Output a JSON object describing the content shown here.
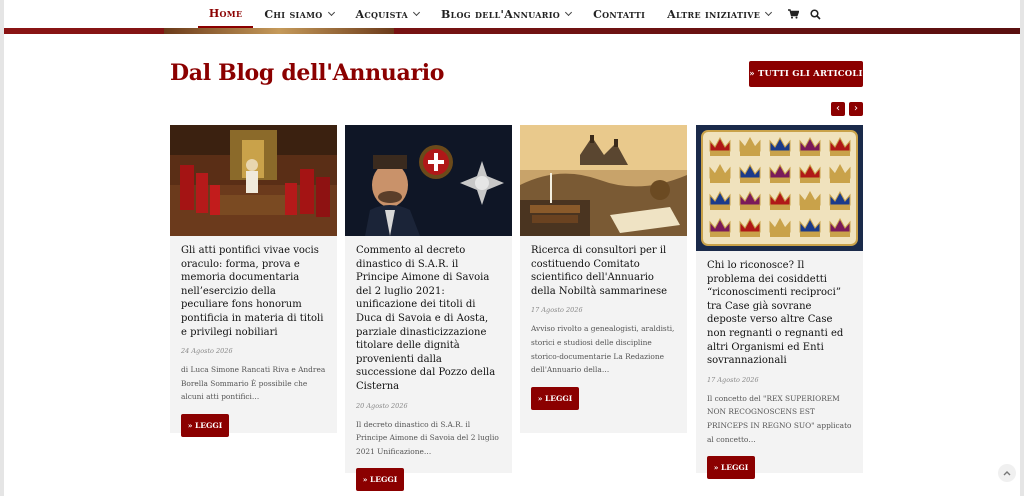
{
  "nav": {
    "items": [
      {
        "label": "Home",
        "active": true,
        "dropdown": false
      },
      {
        "label": "Chi siamo",
        "active": false,
        "dropdown": true
      },
      {
        "label": "Acquista",
        "active": false,
        "dropdown": true
      },
      {
        "label": "Blog dell'Annuario",
        "active": false,
        "dropdown": true
      },
      {
        "label": "Contatti",
        "active": false,
        "dropdown": false
      },
      {
        "label": "Altre iniziative",
        "active": false,
        "dropdown": true
      }
    ],
    "cart_icon": "cart-icon",
    "search_icon": "search-icon"
  },
  "section": {
    "title": "Dal Blog dell'Annuario",
    "all_button": "» TUTTI GLI ARTICOLI",
    "prev_icon": "chevron-left-icon",
    "next_icon": "chevron-right-icon"
  },
  "colors": {
    "accent": "#8b0000",
    "card_bg": "#f3f3f3"
  },
  "cards": [
    {
      "image": "papal-audience-painting",
      "title": "Gli atti pontifici vivae vocis oraculo: forma, prova e memoria documentaria nell’esercizio della peculiare fons honorum pontificia in materia di titoli e privilegi nobiliari",
      "date": "24 Agosto 2026",
      "excerpt": "di Luca Simone Rancati Riva e Andrea Borella Sommario È possibile che alcuni atti pontifici…",
      "button": "» LEGGI"
    },
    {
      "image": "prince-portrait-with-crest",
      "title": "Commento al decreto dinastico di S.A.R. il Principe Aimone di Savoia del 2 luglio 2021: unificazione dei titoli di Duca di Savoia e di Aosta, parziale dinasticizzazione titolare delle dignità provenienti dalla successione dal Pozzo della Cisterna",
      "date": "20 Agosto 2026",
      "excerpt": "Il decreto dinastico di S.A.R. il Principe Aimone di Savoia del 2 luglio 2021 Unificazione…",
      "button": "» LEGGI"
    },
    {
      "image": "san-marino-landscape-books",
      "title": "Ricerca di consultori per il costituendo Comitato scientifico dell'Annuario della Nobiltà sammarinese",
      "date": "17 Agosto 2026",
      "excerpt": "Avviso rivolto a genealogisti, araldisti, storici e studiosi delle discipline storico-documentarie La Redazione dell'Annuario della…",
      "button": "» LEGGI"
    },
    {
      "image": "grid-of-royal-crowns",
      "title": "Chi lo riconosce? Il problema dei cosiddetti “riconoscimenti reciproci” tra Case già sovrane deposte verso altre Case non regnanti o regnanti ed altri Organismi ed Enti sovrannazionali",
      "date": "17 Agosto 2026",
      "excerpt": "Il concetto del \"REX SUPERIOREM NON RECOGNOSCENS EST PRINCEPS IN REGNO SUO\" applicato al concetto…",
      "button": "» LEGGI"
    }
  ],
  "scroll_top_icon": "chevron-up-icon"
}
